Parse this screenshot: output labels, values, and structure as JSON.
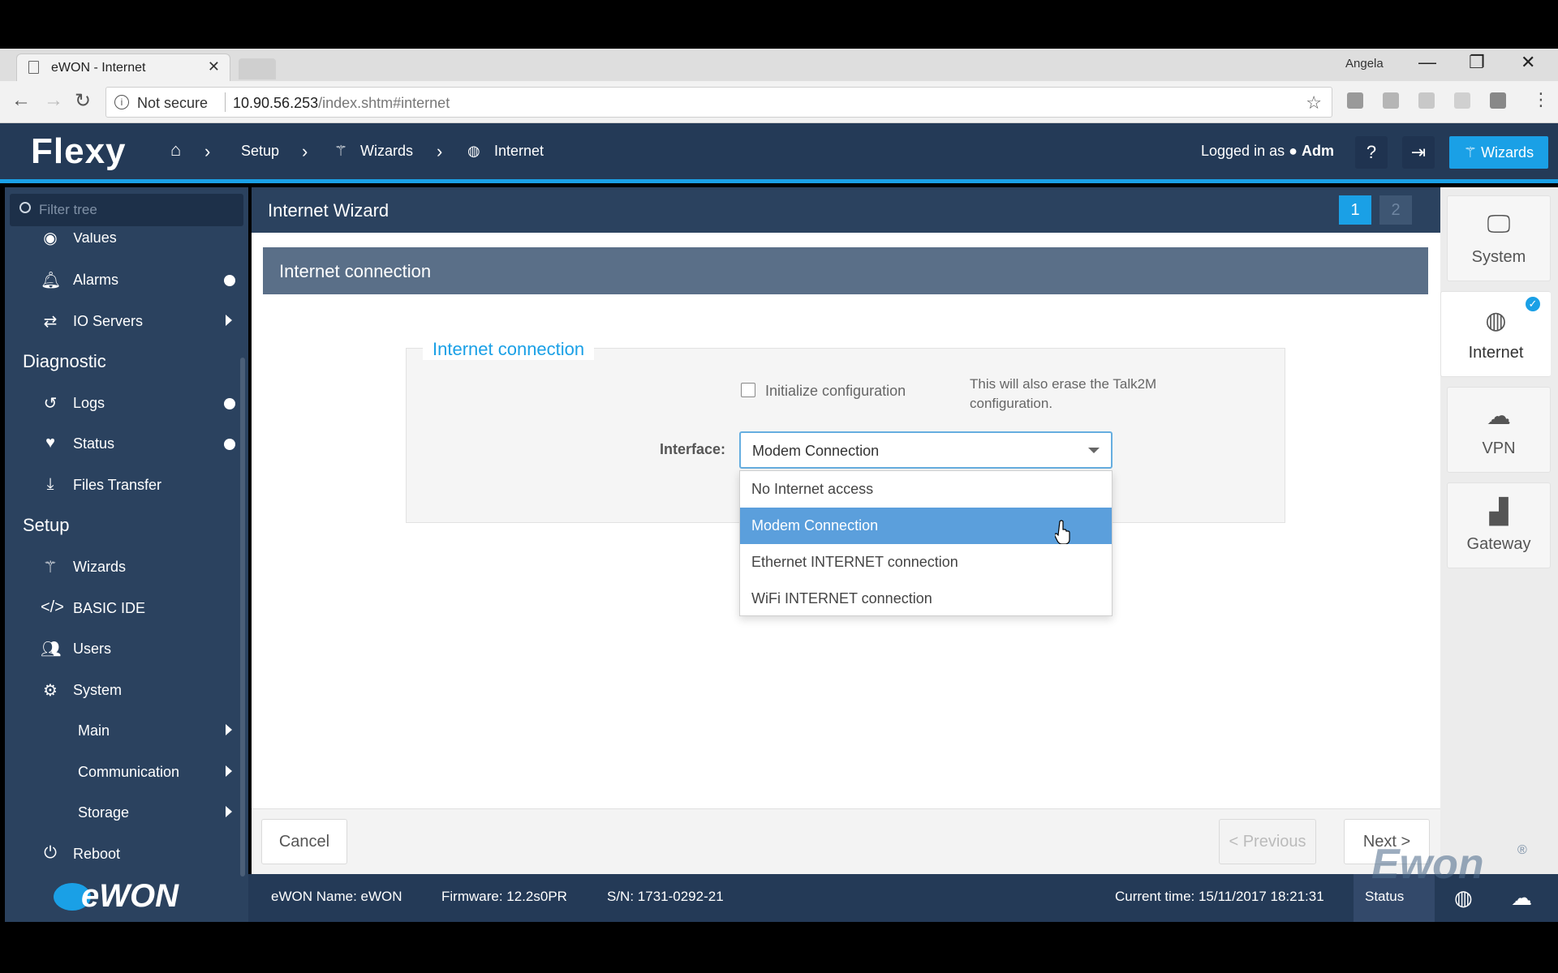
{
  "browser": {
    "tab_title": "eWON - Internet",
    "profile": "Angela",
    "security": "Not secure",
    "url_host": "10.90.56.253",
    "url_path": "/index.shtm#internet"
  },
  "header": {
    "logo": "Flexy",
    "breadcrumb": [
      "Setup",
      "Wizards",
      "Internet"
    ],
    "logged_in_prefix": "Logged in as",
    "logged_in_user": "Adm",
    "wizards_button": "Wizards"
  },
  "sidebar": {
    "filter_placeholder": "Filter tree",
    "items": [
      {
        "label": "Values",
        "icon": "eye-icon"
      },
      {
        "label": "Alarms",
        "icon": "bell-icon"
      },
      {
        "label": "IO Servers",
        "icon": "exchange-icon"
      }
    ],
    "diagnostic_title": "Diagnostic",
    "diagnostic_items": [
      {
        "label": "Logs",
        "icon": "history-icon"
      },
      {
        "label": "Status",
        "icon": "heartbeat-icon"
      },
      {
        "label": "Files Transfer",
        "icon": "download-icon"
      }
    ],
    "setup_title": "Setup",
    "setup_items": [
      {
        "label": "Wizards",
        "icon": "magic-wand-icon"
      },
      {
        "label": "BASIC IDE",
        "icon": "code-icon"
      },
      {
        "label": "Users",
        "icon": "users-icon"
      },
      {
        "label": "System",
        "icon": "gears-icon"
      }
    ],
    "system_children": [
      "Main",
      "Communication",
      "Storage"
    ],
    "reboot": "Reboot",
    "brand": "eWON"
  },
  "wizard": {
    "title": "Internet Wizard",
    "steps": [
      "1",
      "2"
    ],
    "panel_title": "Internet connection",
    "fieldset_legend": "Internet connection",
    "init_config_label": "Initialize configuration",
    "init_config_note": "This will also erase the Talk2M configuration.",
    "interface_label": "Interface:",
    "interface_value": "Modem Connection",
    "interface_options": [
      "No Internet access",
      "Modem Connection",
      "Ethernet INTERNET connection",
      "WiFi INTERNET connection"
    ],
    "selected_index": 1,
    "cancel": "Cancel",
    "previous": "< Previous",
    "next": "Next >"
  },
  "rail": {
    "items": [
      {
        "label": "System",
        "icon": "monitor-icon"
      },
      {
        "label": "Internet",
        "icon": "globe-icon"
      },
      {
        "label": "VPN",
        "icon": "cloud-icon"
      },
      {
        "label": "Gateway",
        "icon": "factory-icon"
      }
    ]
  },
  "status": {
    "name": "eWON Name: eWON",
    "firmware": "Firmware: 12.2s0PR",
    "serial": "S/N: 1731-0292-21",
    "time": "Current time: 15/11/2017 18:21:31",
    "status_label": "Status",
    "watermark": "Ewon"
  },
  "colors": {
    "accent": "#1aa0e6",
    "header_bg": "#243a57",
    "sidebar_bg": "#2b425f",
    "selected_option": "#5b9fdc"
  }
}
